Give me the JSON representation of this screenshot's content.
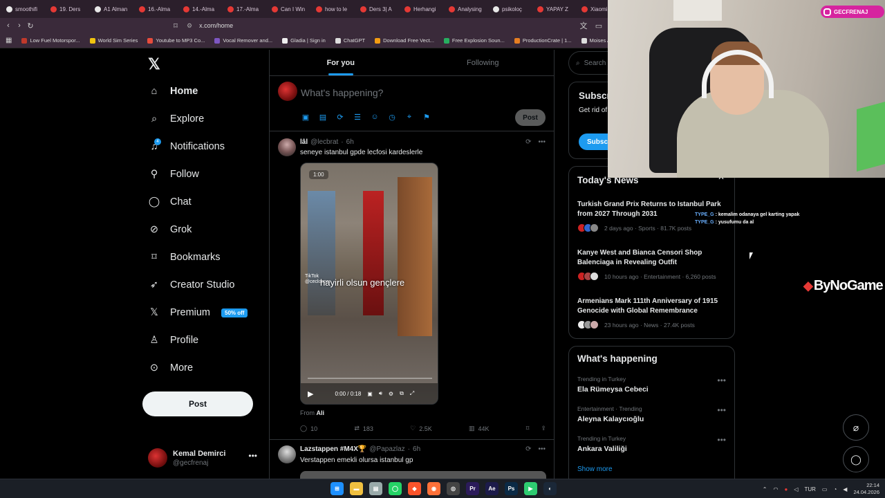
{
  "browser": {
    "tabs": [
      {
        "label": "smoothifi",
        "color": "#e8e8e8"
      },
      {
        "label": "19. Ders",
        "color": "#e53935"
      },
      {
        "label": "A1 Alman",
        "color": "#e8e8e8"
      },
      {
        "label": "16.-Alma",
        "color": "#e53935"
      },
      {
        "label": "14.-Alma",
        "color": "#e53935"
      },
      {
        "label": "17.-Alma",
        "color": "#e53935"
      },
      {
        "label": "Can I Win",
        "color": "#e53935"
      },
      {
        "label": "how to le",
        "color": "#e53935"
      },
      {
        "label": "Ders 3| A",
        "color": "#e53935"
      },
      {
        "label": "Herhangi",
        "color": "#e53935"
      },
      {
        "label": "Analysing",
        "color": "#e53935"
      },
      {
        "label": "psikoloç",
        "color": "#e8e8e8"
      },
      {
        "label": "YAPAY Z",
        "color": "#e53935"
      },
      {
        "label": "Xiaomi",
        "color": "#e53935"
      }
    ],
    "url": "x.com/home",
    "bookmarks": [
      {
        "label": "Low Fuel Motorspor...",
        "color": "#c0392b"
      },
      {
        "label": "World Sim Series",
        "color": "#f1c40f"
      },
      {
        "label": "Youtube to MP3 Co...",
        "color": "#e74c3c"
      },
      {
        "label": "Vocal Remover and...",
        "color": "#7e57c2"
      },
      {
        "label": "Gladia | Sign in",
        "color": "#eeeeee"
      },
      {
        "label": "ChatGPT",
        "color": "#dddddd"
      },
      {
        "label": "Download Free Vect...",
        "color": "#f39c12"
      },
      {
        "label": "Free Explosion Soun...",
        "color": "#27ae60"
      },
      {
        "label": "ProductionCrate | 1...",
        "color": "#e67e22"
      },
      {
        "label": "Moises App: M",
        "color": "#dddddd"
      }
    ]
  },
  "nav": {
    "items": [
      {
        "label": "Home",
        "icon": "home-icon"
      },
      {
        "label": "Explore",
        "icon": "search-icon"
      },
      {
        "label": "Notifications",
        "icon": "bell-icon"
      },
      {
        "label": "Follow",
        "icon": "add-person-icon"
      },
      {
        "label": "Chat",
        "icon": "chat-icon"
      },
      {
        "label": "Grok",
        "icon": "grok-icon"
      },
      {
        "label": "Bookmarks",
        "icon": "bookmark-icon"
      },
      {
        "label": "Creator Studio",
        "icon": "rocket-icon"
      },
      {
        "label": "Premium",
        "icon": "x-icon"
      },
      {
        "label": "Profile",
        "icon": "person-icon"
      },
      {
        "label": "More",
        "icon": "more-circle-icon"
      }
    ],
    "notification_count": "4",
    "premium_badge": "50% off",
    "post_label": "Post",
    "account": {
      "name": "Kemal Demirci",
      "handle": "@gecfrenaj"
    }
  },
  "feed": {
    "tabs": [
      "For you",
      "Following"
    ],
    "compose_placeholder": "What's happening?",
    "compose_post_label": "Post",
    "tweet1": {
      "name": "lâl",
      "handle": "@lecbrat",
      "time": "6h",
      "text": "seneye istanbul gpde lecfosi kardeslerle",
      "video_timer": "1:00",
      "video_caption": "hayirli olsun gençlere",
      "video_tiktok": "TikTok",
      "video_tiktok_handle": "@ceclosper",
      "video_time": "0:00 / 0:18",
      "from_label": "From",
      "from_name": "Ali",
      "replies": "10",
      "reposts": "183",
      "likes": "2.5K",
      "views": "44K"
    },
    "tweet2": {
      "name": "Lazstappen #M4X🏆",
      "handle": "@Papazlaz",
      "time": "6h",
      "text": "Verstappen emekli olursa istanbul gp"
    }
  },
  "sidebar": {
    "search_placeholder": "Search",
    "subscribe": {
      "title": "Subscri",
      "text": "Get rid of ads, see your replies ar",
      "button": "Subscri"
    },
    "news": {
      "title": "Today's News",
      "items": [
        {
          "title": "Turkish Grand Prix Returns to Istanbul Park from 2027 Through 2031",
          "meta": "2 days ago · Sports · 81.7K posts"
        },
        {
          "title": "Kanye West and Bianca Censori Shop Balenciaga in Revealing Outfit",
          "meta": "10 hours ago · Entertainment · 6,260 posts"
        },
        {
          "title": "Armenians Mark 111th Anniversary of 1915 Genocide with Global Remembrance",
          "meta": "23 hours ago · News · 27.4K posts"
        }
      ]
    },
    "happening": {
      "title": "What's happening",
      "trends": [
        {
          "context": "Trending in Turkey",
          "name": "Ela Rümeysa Cebeci"
        },
        {
          "context": "Entertainment · Trending",
          "name": "Aleyna Kalaycıoğlu"
        },
        {
          "context": "Trending in Turkey",
          "name": "Ankara Valiliği"
        }
      ],
      "show_more": "Show more"
    }
  },
  "overlay": {
    "instagram": "GECFRENAJ",
    "chat": [
      {
        "user": "TYPE_G",
        "msg": ": kemalim odanaya gel karting yapak"
      },
      {
        "user": "TYPE_G",
        "msg": ": yusufumu da al"
      }
    ],
    "sponsor": "ByNoGame"
  },
  "taskbar": {
    "lang": "TUR",
    "time": "22:14",
    "date": "24.04.2026"
  }
}
